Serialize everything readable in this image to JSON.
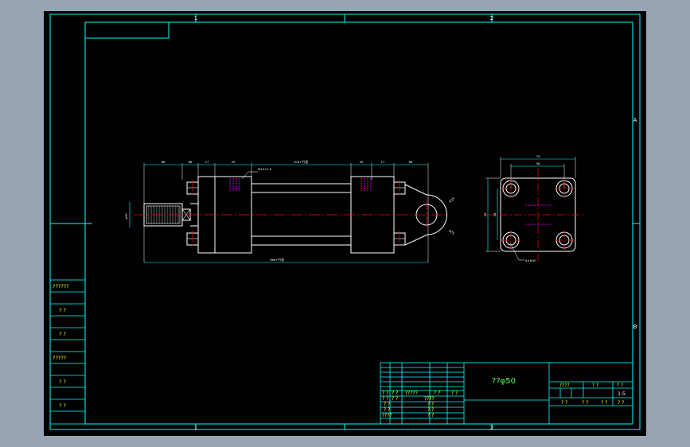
{
  "zone_labels": {
    "top": [
      "1",
      "2"
    ],
    "bottom": [
      "1",
      "2"
    ],
    "right": [
      "A",
      "B"
    ]
  },
  "side_table": [
    "??????",
    "? ?",
    "? ?",
    "?????",
    "? ?",
    "? ?"
  ],
  "title_block": {
    "drawing_title": "??φ50",
    "scale": "1:5",
    "left_rows": [
      [
        "? ?",
        "? ?",
        "?????",
        "? ?",
        "? ?"
      ],
      [
        "? ?",
        "? ?",
        "????"
      ],
      [
        "? ?",
        "? ?"
      ],
      [
        "? ?",
        "? ?"
      ],
      [
        "????",
        "? ?"
      ]
    ],
    "right_header": [
      "????",
      "? ?",
      "? ?"
    ],
    "right_footer": [
      "? ?",
      "? ?",
      "? ?",
      "? ?"
    ]
  },
  "front_view": {
    "dims_top": [
      "88",
      "88",
      "17",
      "20",
      "304+行程",
      "20",
      "17",
      "88"
    ],
    "dim_bottom": "566+行程",
    "dim_left": "φ30",
    "note_port": "M12×1.5",
    "dim_eye_top": "R35",
    "dim_eye_bot": "φ25"
  },
  "side_view": {
    "dims_top": [
      "75",
      "58"
    ],
    "dims_left": [
      "45",
      "58"
    ],
    "note_bolt": "4×M10"
  },
  "colors": {
    "background": "#000000",
    "frame": "#00ffff",
    "object": "#ffffff",
    "centerline": "#ff0000",
    "hidden": "#ff00ff",
    "text": "#ffff00",
    "title": "#4dff4d"
  }
}
